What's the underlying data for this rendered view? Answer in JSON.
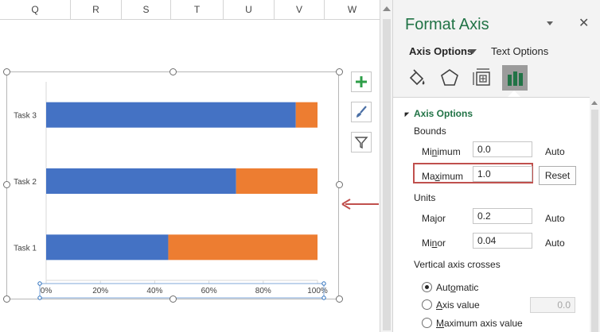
{
  "sheet": {
    "columns": [
      "Q",
      "R",
      "S",
      "T",
      "U",
      "V",
      "W"
    ]
  },
  "chart": {
    "side_buttons": [
      "plus-icon",
      "brush-icon",
      "filter-icon"
    ]
  },
  "chart_data": {
    "type": "bar",
    "orientation": "horizontal",
    "stacked": true,
    "categories": [
      "Task 1",
      "Task 2",
      "Task 3"
    ],
    "series": [
      {
        "color": "#4472c4",
        "values": [
          0.45,
          0.7,
          0.92
        ]
      },
      {
        "color": "#ed7d31",
        "values": [
          0.55,
          0.3,
          0.08
        ]
      }
    ],
    "x_ticks": [
      "0%",
      "20%",
      "40%",
      "60%",
      "80%",
      "100%"
    ],
    "xlim": [
      0,
      1
    ],
    "grid": false,
    "legend": "none"
  },
  "pane": {
    "title": "Format Axis",
    "tabs": {
      "axis_options": "Axis Options",
      "text_options": "Text Options"
    },
    "icons": [
      "fill-line-icon",
      "effects-icon",
      "size-properties-icon",
      "axis-options-bar-chart-icon"
    ],
    "section_title": "Axis Options",
    "bounds_label": "Bounds",
    "minimum": {
      "label_pre": "Mi",
      "label_u": "n",
      "label_post": "imum",
      "value": "0.0",
      "status": "Auto"
    },
    "maximum": {
      "label_pre": "Ma",
      "label_u": "x",
      "label_post": "imum",
      "value": "1.0",
      "reset": "Reset"
    },
    "units_label": "Units",
    "major": {
      "label_pre": "Ma",
      "label_u": "j",
      "label_post": "or",
      "value": "0.2",
      "status": "Auto"
    },
    "minor": {
      "label_pre": "Mi",
      "label_u": "n",
      "label_post": "or",
      "value": "0.04",
      "status": "Auto"
    },
    "crosses_label": "Vertical axis crosses",
    "crosses_options": {
      "automatic": {
        "pre": "Aut",
        "u": "o",
        "post": "matic",
        "checked": true
      },
      "axis_value": {
        "pre": "",
        "u": "A",
        "post": "xis value",
        "value": "0.0"
      },
      "maximum_axis_value": {
        "pre": "",
        "u": "M",
        "post": "aximum axis value"
      }
    }
  },
  "colors": {
    "accent_green": "#217346",
    "highlight_red": "#c0504d",
    "bar_blue": "#4472c4",
    "bar_orange": "#ed7d31"
  }
}
